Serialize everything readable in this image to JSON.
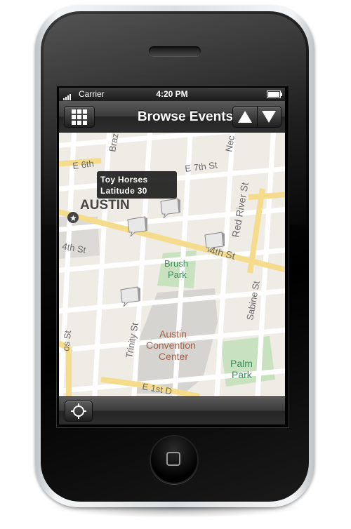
{
  "status_bar": {
    "carrier": "Carrier",
    "time": "4:20 PM"
  },
  "nav_bar": {
    "title": "Browse Events",
    "grid_icon": "grid-icon",
    "prev_icon": "triangle-up-icon",
    "next_icon": "triangle-down-icon"
  },
  "map": {
    "labels": {
      "brazos": "Braz",
      "e6th": "E 6th",
      "e7th": "E 7th St",
      "neches": "Nec",
      "red_river": "Red River St",
      "austin": "AUSTIN",
      "w4th": "4th St",
      "e4th": "4th St",
      "brush_park_1": "Brush",
      "brush_park_2": "Park",
      "sabine": "Sabine St",
      "trinity": "Trinity St",
      "convention_1": "Austin",
      "convention_2": "Convention",
      "convention_3": "Center",
      "palm_park_1": "Palm",
      "palm_park_2": "Park",
      "cos": "os St",
      "e1st": "E 1st D"
    },
    "callout": {
      "title": "Toy Horses",
      "subtitle": "Latitude 30"
    },
    "colors": {
      "block": "#efece6",
      "street": "#ffffff",
      "major_road": "#f5dc8c",
      "park": "#c8e2c0",
      "convention": "#d6d4d0",
      "label": "#6a6a6a",
      "convention_label": "#a06048",
      "park_label": "#3f8f5a"
    }
  },
  "toolbar": {
    "locate_icon": "crosshair-icon"
  }
}
